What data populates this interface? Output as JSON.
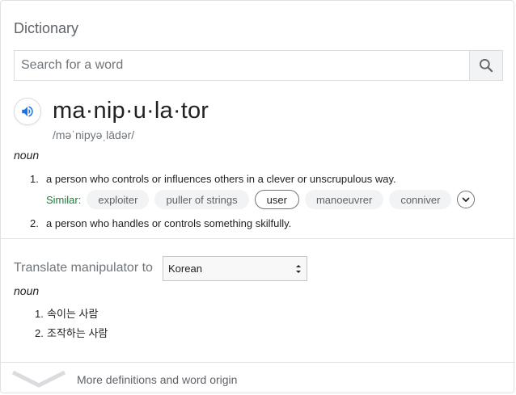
{
  "app": {
    "title": "Dictionary"
  },
  "search": {
    "placeholder": "Search for a word",
    "value": ""
  },
  "entry": {
    "headword": "ma·nip·u·la·tor",
    "phonetic": "/məˈnipyəˌlādər/",
    "part_of_speech": "noun",
    "definitions": [
      {
        "num": "1.",
        "text": "a person who controls or influences others in a clever or unscrupulous way.",
        "similar_label": "Similar:",
        "similar": [
          "exploiter",
          "puller of strings",
          "user",
          "manoeuvrer",
          "conniver"
        ]
      },
      {
        "num": "2.",
        "text": "a person who handles or controls something skilfully."
      }
    ]
  },
  "translate": {
    "label": "Translate manipulator to",
    "language": "Korean",
    "part_of_speech": "noun",
    "results": [
      {
        "num": "1.",
        "text": "속이는 사람"
      },
      {
        "num": "2.",
        "text": "조작하는 사람"
      }
    ]
  },
  "footer": {
    "more_label": "More definitions and word origin"
  },
  "icons": {
    "speaker": "speaker-icon",
    "search": "search-icon",
    "expand": "chevron-down-icon",
    "more": "chevron-down-icon"
  },
  "colors": {
    "accent": "#1a73e8",
    "similar_label": "#188038",
    "muted": "#70757a"
  }
}
